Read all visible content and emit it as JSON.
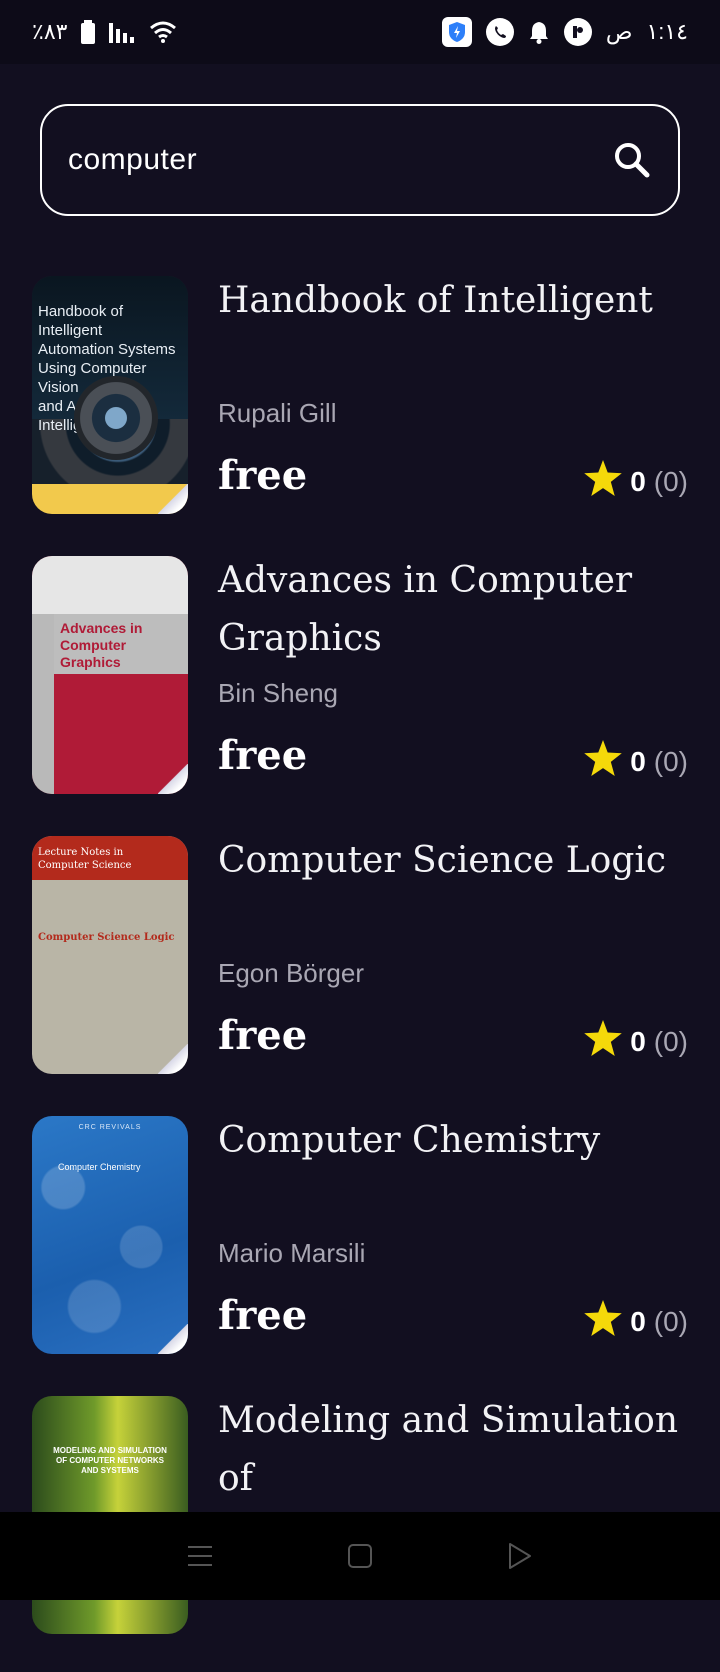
{
  "status_bar": {
    "battery_percent": "٪٨٣",
    "time": "١:١٤",
    "ampm": "ص"
  },
  "search": {
    "value": "computer"
  },
  "books": [
    {
      "title": "Handbook of Intelligent",
      "author": "Rupali Gill",
      "price": "free",
      "rating": "0",
      "rating_count": "(0)",
      "cover_text": [
        "Handbook of Intelligent",
        "Automation Systems",
        "Using Computer Vision",
        "and Artificial Intelligence"
      ]
    },
    {
      "title": "Advances in Computer Graphics",
      "author": "Bin Sheng",
      "price": "free",
      "rating": "0",
      "rating_count": "(0)",
      "cover_text": [
        "Advances in",
        "Computer Graphics"
      ]
    },
    {
      "title": "Computer Science Logic",
      "author": "Egon Börger",
      "price": "free",
      "rating": "0",
      "rating_count": "(0)",
      "cover_text": [
        "Lecture Notes in",
        "Computer Science",
        "Computer Science Logic"
      ]
    },
    {
      "title": "Computer Chemistry",
      "author": "Mario Marsili",
      "price": "free",
      "rating": "0",
      "rating_count": "(0)",
      "cover_text": [
        "CRC REVIVALS",
        "Computer Chemistry"
      ]
    },
    {
      "title": "Modeling and Simulation of",
      "author": "",
      "price": "",
      "rating": "",
      "rating_count": "",
      "cover_text": [
        "MODELING AND SIMULATION",
        "OF COMPUTER NETWORKS",
        "AND SYSTEMS"
      ]
    }
  ],
  "colors": {
    "background": "#120f20",
    "star": "#f5d90a",
    "muted_text": "#a9a7b3"
  },
  "icons": {
    "search": "search-icon",
    "star": "star-icon",
    "menu": "menu-icon",
    "home": "home-icon",
    "back": "back-icon"
  }
}
